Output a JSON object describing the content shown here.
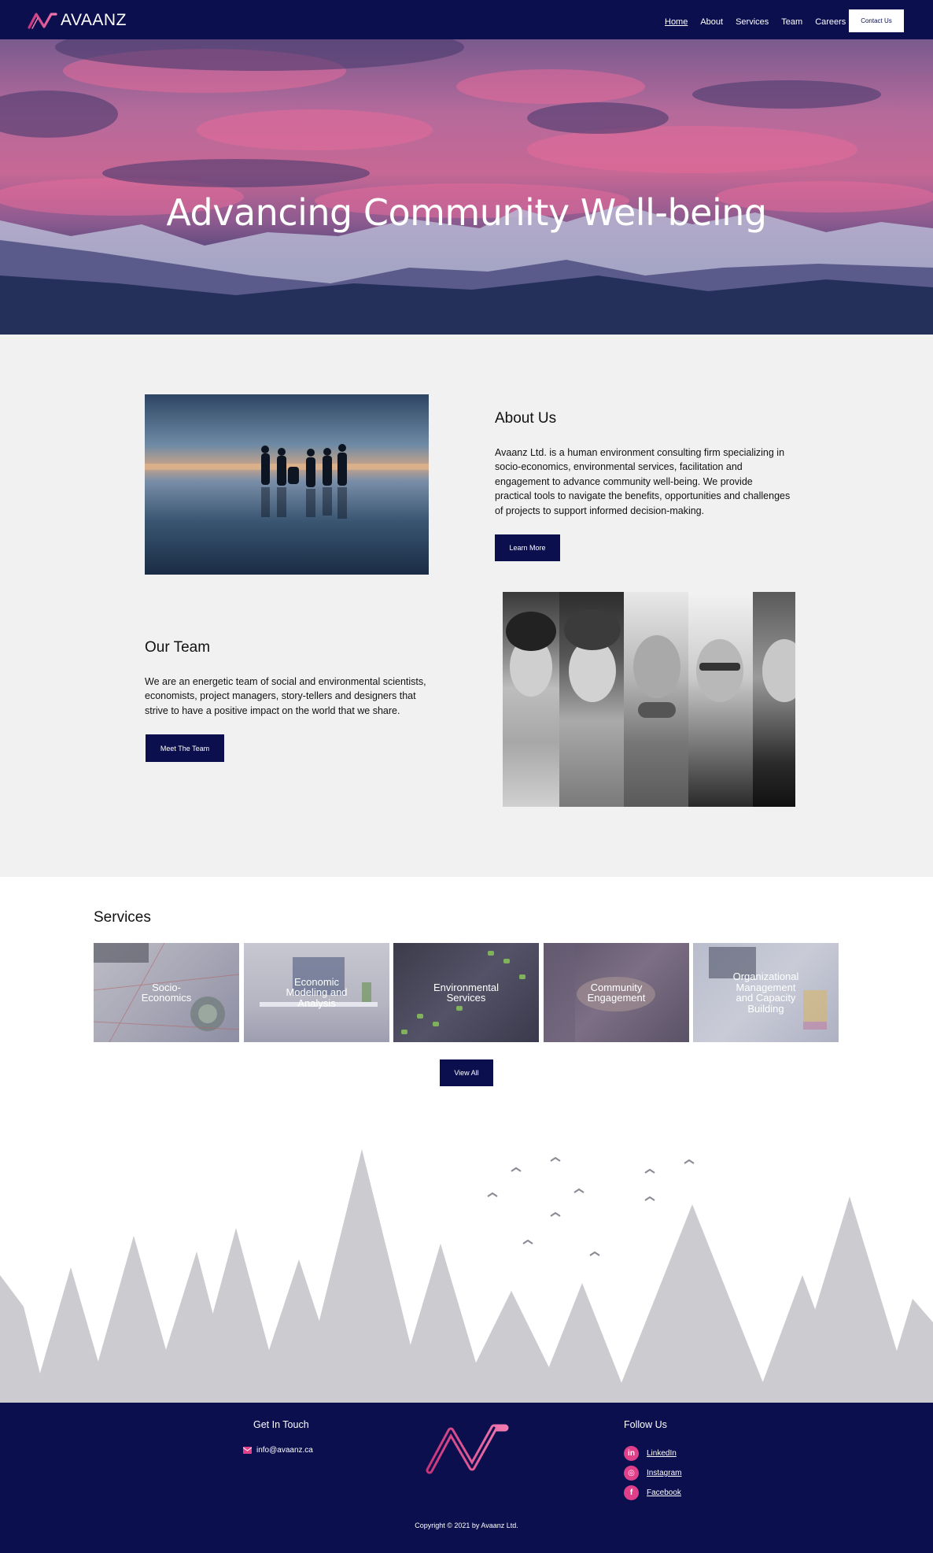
{
  "nav": {
    "brand": "AVAANZ",
    "items": [
      {
        "label": "Home"
      },
      {
        "label": "About"
      },
      {
        "label": "Services"
      },
      {
        "label": "Team"
      },
      {
        "label": "Careers"
      }
    ],
    "contact_label": "Contact Us"
  },
  "hero": {
    "title": "Advancing Community Well-being"
  },
  "about": {
    "title": "About Us",
    "text": "Avaanz Ltd. is a human environment consulting firm specializing in socio-economics, environmental services, facilitation and engagement to advance community well-being. We provide practical tools to navigate the benefits, opportunities and challenges of projects to support informed decision-making.",
    "button_label": "Learn More"
  },
  "team": {
    "title": "Our Team",
    "text": "We are an energetic team of social and environmental scientists, economists, project managers, story-tellers and designers that strive to have a positive impact on the world that we share.",
    "button_label": "Meet The Team"
  },
  "services": {
    "title": "Services",
    "tiles": [
      {
        "label": "Socio-\nEconomics"
      },
      {
        "label": "Economic\nModeling and\nAnalysis"
      },
      {
        "label": "Environmental\nServices"
      },
      {
        "label": "Community\nEngagement"
      },
      {
        "label": "Organizational\nManagement\nand Capacity\nBuilding"
      }
    ],
    "button_label": "View All"
  },
  "footer": {
    "get_in_touch": "Get In Touch",
    "email": "info@avaanz.ca",
    "follow_us": "Follow Us",
    "social": [
      {
        "label": "LinkedIn",
        "icon": "in"
      },
      {
        "label": "Instagram",
        "icon": "◎"
      },
      {
        "label": "Facebook",
        "icon": "f"
      }
    ],
    "copyright": "Copyright © 2021 by Avaanz Ltd."
  },
  "colors": {
    "navy": "#0b0f4d",
    "pink": "#e0408a",
    "grey_bg": "#f1f1f1"
  }
}
